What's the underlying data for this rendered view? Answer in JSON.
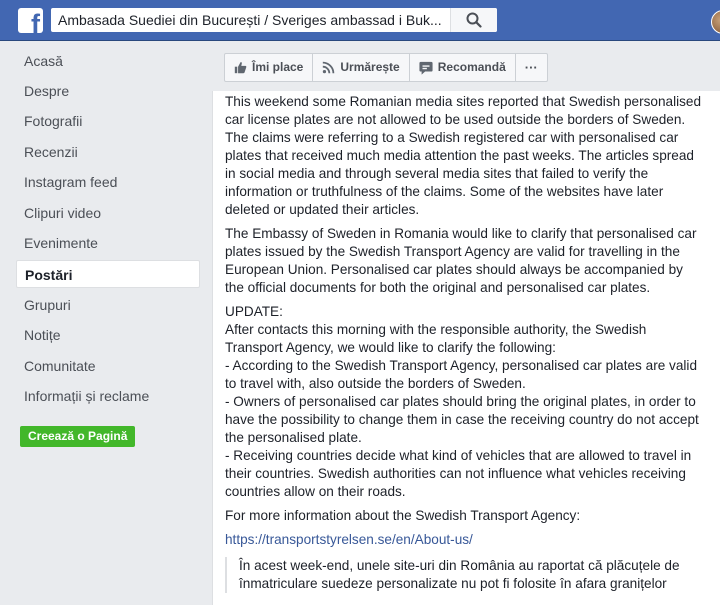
{
  "topbar": {
    "logo_glyph": "f",
    "search_value": "Ambasada Suediei din București / Sveriges ambassad i Buk...",
    "search_icon": "search-icon"
  },
  "sidebar": {
    "items": [
      {
        "label": "Acasă"
      },
      {
        "label": "Despre"
      },
      {
        "label": "Fotografii"
      },
      {
        "label": "Recenzii"
      },
      {
        "label": "Instagram feed"
      },
      {
        "label": "Clipuri video"
      },
      {
        "label": "Evenimente"
      },
      {
        "label": "Postări",
        "active": true
      },
      {
        "label": "Grupuri"
      },
      {
        "label": "Notițe"
      },
      {
        "label": "Comunitate"
      },
      {
        "label": "Informații și reclame"
      }
    ],
    "create_page": "Creează o Pagină"
  },
  "actions": {
    "like": "Îmi place",
    "follow": "Urmărește",
    "recommend": "Recomandă",
    "more": "···"
  },
  "post": {
    "para1": "This weekend some Romanian media sites reported that Swedish personalised car license plates are not allowed to be used outside the borders of Sweden. The claims were referring to a Swedish registered car with personalised car plates that received much media attention the past weeks. The articles spread in social media and through several media sites that failed to verify the information or truthfulness of the claims. Some of the websites have later deleted or updated their articles.",
    "para2": "The Embassy of Sweden in Romania would like to clarify that personalised car plates issued by the Swedish Transport Agency are valid for travelling in the European Union. Personalised car plates should always be accompanied by the official documents for both the original and personalised car plates.",
    "update_heading": "UPDATE:",
    "update_intro": "After contacts this morning with the responsible authority, the Swedish Transport Agency, we would like to clarify the following:",
    "bullet1": "- According to the Swedish Transport Agency, personalised car plates are valid to travel with, also outside the borders of Sweden.",
    "bullet2": "- Owners of personalised car plates should bring the original plates, in order to have the possibility to change them in case the receiving country do not accept the personalised plate.",
    "bullet3": "- Receiving countries decide what kind of vehicles that are allowed to travel in their countries. Swedish authorities can not influence what vehicles receiving countries allow on their roads.",
    "more_info": "For more information about the Swedish Transport Agency:",
    "link": "https://transportstyrelsen.se/en/About-us/",
    "quote": "În acest week-end, unele site-uri din România au raportat că plăcuțele de înmatriculare suedeze personalizate nu pot fi folosite în afara granițelor"
  },
  "colors": {
    "topbar": "#4267b2",
    "link": "#385898",
    "create_button": "#42b72a"
  }
}
